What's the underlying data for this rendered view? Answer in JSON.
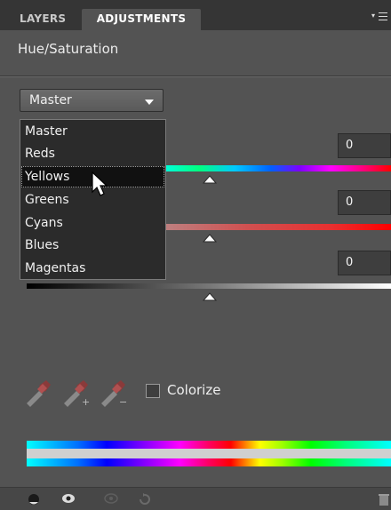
{
  "tabs": [
    {
      "label": "LAYERS",
      "active": false
    },
    {
      "label": "ADJUSTMENTS",
      "active": true
    }
  ],
  "panel_title": "Hue/Saturation",
  "channel_select": {
    "value": "Master",
    "options": [
      "Master",
      "Reds",
      "Yellows",
      "Greens",
      "Cyans",
      "Blues",
      "Magentas"
    ],
    "highlighted": "Yellows"
  },
  "sliders": {
    "hue": {
      "value": "0",
      "position": 0.5
    },
    "saturation": {
      "value": "0",
      "position": 0.5
    },
    "lightness": {
      "value": "0",
      "position": 0.5
    }
  },
  "colorize": {
    "label": "Colorize",
    "checked": false
  },
  "icons": {
    "panel_menu": "panel-menu-icon",
    "droppers": [
      "eyedropper-icon",
      "eyedropper-add-icon",
      "eyedropper-subtract-icon"
    ],
    "bottom": [
      "clip-layer-icon",
      "visibility-eye-icon",
      "view-previous-icon",
      "reset-icon",
      "trash-icon"
    ]
  },
  "colors": {
    "panel_bg": "#535353",
    "tab_bar_bg": "#353535",
    "list_bg": "#2b2b2b",
    "highlight_bg": "#111111"
  }
}
